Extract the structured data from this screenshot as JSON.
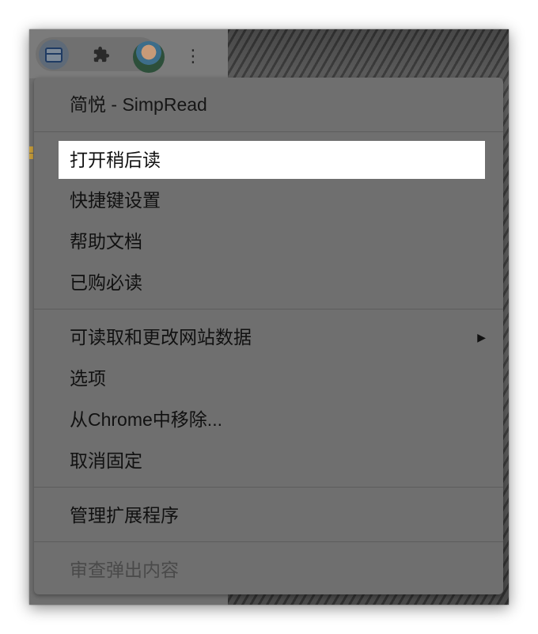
{
  "toolbar": {
    "reader_icon": "simpread-reader-icon",
    "extensions_icon": "puzzle-icon",
    "avatar": "profile-avatar",
    "menu_icon": "kebab-icon"
  },
  "menu": {
    "title": "简悦 - SimpRead",
    "group1": [
      "打开稍后读",
      "快捷键设置",
      "帮助文档",
      "已购必读"
    ],
    "site_data": "可读取和更改网站数据",
    "submenu_arrow": "▶",
    "group2": [
      "选项",
      "从Chrome中移除...",
      "取消固定"
    ],
    "manage": "管理扩展程序",
    "inspect": "审查弹出内容"
  }
}
